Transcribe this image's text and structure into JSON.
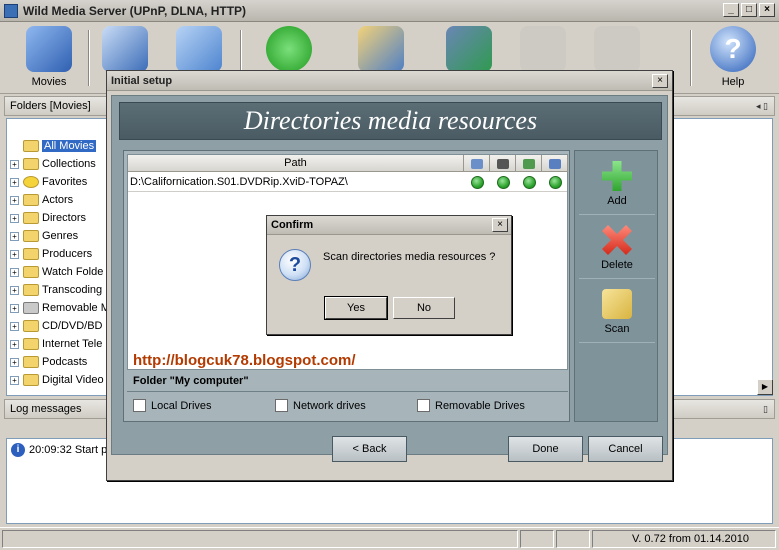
{
  "window": {
    "title": "Wild Media Server (UPnP, DLNA, HTTP)"
  },
  "toolbar": {
    "items": [
      {
        "label": "Movies",
        "icon": "movies-icon"
      },
      {
        "label": "",
        "icon": "music-icon"
      },
      {
        "label": "",
        "icon": "photos-icon"
      },
      {
        "label": "",
        "icon": "refresh-icon"
      },
      {
        "label": "",
        "icon": "settings-icon"
      },
      {
        "label": "",
        "icon": "transcode-icon"
      },
      {
        "label": "",
        "icon": "disabled-icon"
      },
      {
        "label": "",
        "icon": "disabled-icon"
      },
      {
        "label": "Help",
        "icon": "help-icon"
      }
    ]
  },
  "folders_panel": {
    "title": "Folders [Movies]",
    "items": [
      "All Movies",
      "Collections",
      "Favorites",
      "Actors",
      "Directors",
      "Genres",
      "Producers",
      "Watch Folde",
      "Transcoding",
      "Removable M",
      "CD/DVD/BD",
      "Internet Tele",
      "Podcasts",
      "Digital Video"
    ]
  },
  "log_panel": {
    "title": "Log messages",
    "line": "20:09:32 Start p"
  },
  "status": {
    "version": "V. 0.72 from 01.14.2010"
  },
  "setup_dialog": {
    "title": "Initial setup",
    "banner": "Directories media resources",
    "table_header_path": "Path",
    "row_path": "D:\\Californication.S01.DVDRip.XviD-TOPAZ\\",
    "url": "http://blogcuk78.blogspot.com/",
    "group_label": "Folder \"My computer\"",
    "checkboxes": [
      "Local Drives",
      "Network drives",
      "Removable Drives"
    ],
    "side_buttons": [
      "Add",
      "Delete",
      "Scan"
    ],
    "buttons": {
      "back": "< Back",
      "done": "Done",
      "cancel": "Cancel"
    }
  },
  "confirm_dialog": {
    "title": "Confirm",
    "message": "Scan directories media resources ?",
    "yes": "Yes",
    "no": "No"
  },
  "colors": {
    "accent": "#316ac5",
    "banner": "#4f6169",
    "url": "#b33a00",
    "ok": "#2fa52f"
  }
}
